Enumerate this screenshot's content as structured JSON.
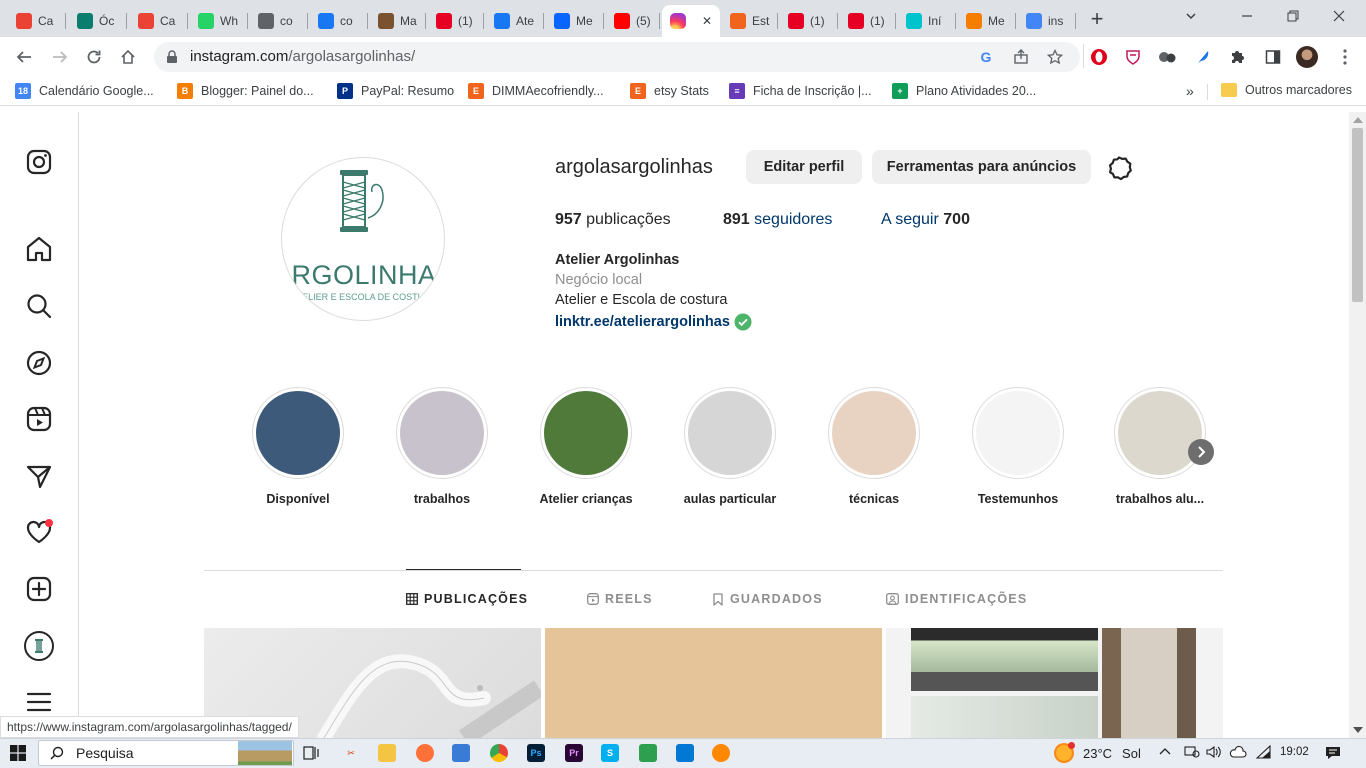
{
  "browser": {
    "tabs": [
      {
        "label": "Ca",
        "icon": "gmail-icon",
        "color": "#ea4335"
      },
      {
        "label": "Óc",
        "icon": "v-icon",
        "color": "#0a7d6e"
      },
      {
        "label": "Ca",
        "icon": "gmail-icon",
        "color": "#ea4335"
      },
      {
        "label": "Wh",
        "icon": "whatsapp-icon",
        "color": "#25d366"
      },
      {
        "label": "co",
        "icon": "globe-icon",
        "color": "#5f6368"
      },
      {
        "label": "co",
        "icon": "facebook-icon",
        "color": "#1877f2"
      },
      {
        "label": "Ma",
        "icon": "image-icon",
        "color": "#7a5230"
      },
      {
        "label": "(1)",
        "icon": "pinterest-icon",
        "color": "#e60023"
      },
      {
        "label": "Ate",
        "icon": "facebook-icon",
        "color": "#1877f2"
      },
      {
        "label": "Me",
        "icon": "meta-icon",
        "color": "#0866ff"
      },
      {
        "label": "(5)",
        "icon": "youtube-icon",
        "color": "#ff0000"
      },
      {
        "label": "",
        "icon": "instagram-icon",
        "color": "#e1306c"
      },
      {
        "label": "Est",
        "icon": "etsy-icon",
        "color": "#f1641e"
      },
      {
        "label": "(1)",
        "icon": "pinterest-icon",
        "color": "#e60023"
      },
      {
        "label": "(1)",
        "icon": "pinterest-icon",
        "color": "#e60023"
      },
      {
        "label": "Iní",
        "icon": "canva-icon",
        "color": "#00c4cc"
      },
      {
        "label": "Me",
        "icon": "blogger-icon",
        "color": "#f57d00"
      },
      {
        "label": "ins",
        "icon": "google-icon",
        "color": "#4285f4"
      }
    ],
    "new_tab_glyph": "+",
    "url_host": "instagram.com",
    "url_path": "/argolasargolinhas/",
    "bookmarks": [
      {
        "label": "Calendário Google...",
        "icon": "calendar-icon",
        "color": "#4285f4",
        "glyph": "18"
      },
      {
        "label": "Blogger: Painel do...",
        "icon": "blogger-icon",
        "color": "#f57d00",
        "glyph": "B"
      },
      {
        "label": "PayPal: Resumo",
        "icon": "paypal-icon",
        "color": "#003087",
        "glyph": "P"
      },
      {
        "label": "DIMMAecofriendly...",
        "icon": "etsy-icon",
        "color": "#f1641e",
        "glyph": "E"
      },
      {
        "label": "etsy Stats",
        "icon": "etsy-icon",
        "color": "#f1641e",
        "glyph": "E"
      },
      {
        "label": "Ficha de Inscrição |...",
        "icon": "forms-icon",
        "color": "#673ab7",
        "glyph": "≡"
      },
      {
        "label": "Plano Atividades 20...",
        "icon": "sheets-icon",
        "color": "#0f9d58",
        "glyph": "+"
      }
    ],
    "more_bookmarks": "»",
    "other_bookmarks": "Outros marcadores",
    "status_url": "https://www.instagram.com/argolasargolinhas/tagged/"
  },
  "profile": {
    "username": "argolasargolinhas",
    "edit_button": "Editar perfil",
    "ads_button": "Ferramentas para anúncios",
    "posts_count": "957",
    "posts_label": "publicações",
    "followers_count": "891",
    "followers_label": "seguidores",
    "following_label": "A seguir",
    "following_count": "700",
    "full_name": "Atelier Argolinhas",
    "category": "Negócio local",
    "bio": "Atelier e Escola de costura",
    "link": "linktr.ee/atelierargolinhas",
    "logo_text": "ARGOLINHAS",
    "logo_subtext": "ATELIER E ESCOLA DE COSTURA"
  },
  "highlights": [
    {
      "label": "Disponível",
      "color": "#3d5a7a"
    },
    {
      "label": "trabalhos",
      "color": "#c7c2cc"
    },
    {
      "label": "Atelier crianças",
      "color": "#4f7a3a"
    },
    {
      "label": "aulas particular",
      "color": "#d6d6d6"
    },
    {
      "label": "técnicas",
      "color": "#e8d3c3"
    },
    {
      "label": "Testemunhos",
      "color": "#f4f4f4"
    },
    {
      "label": "trabalhos alu...",
      "color": "#ddd8cd"
    }
  ],
  "profile_tabs": {
    "posts": "PUBLICAÇÕES",
    "reels": "REELS",
    "saved": "GUARDADOS",
    "tagged": "IDENTIFICAÇÕES"
  },
  "taskbar": {
    "search_placeholder": "Pesquisa",
    "weather_temp": "23°C",
    "weather_text": "Sol",
    "time": "19:02"
  },
  "colors": {
    "link": "#00376b",
    "verified": "#4db56a",
    "notification_dot": "#ff3040"
  }
}
